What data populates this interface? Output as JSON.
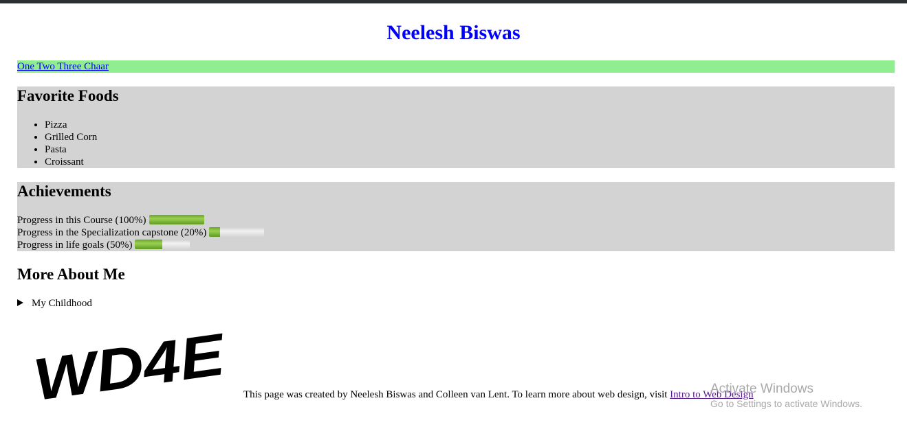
{
  "header": {
    "title": "Neelesh Biswas"
  },
  "nav": {
    "link_text": "One Two Three Chaar"
  },
  "favorite_foods": {
    "title": "Favorite Foods",
    "items": [
      "Pizza",
      "Grilled Corn",
      "Pasta",
      "Croissant"
    ]
  },
  "achievements": {
    "title": "Achievements",
    "rows": [
      {
        "label": "Progress in this Course (100%)",
        "value": 100
      },
      {
        "label": "Progress in the Specialization capstone (20%)",
        "value": 20
      },
      {
        "label": "Progress in life goals (50%)",
        "value": 50
      }
    ]
  },
  "more_about": {
    "title": "More About Me",
    "details_summary": "My Childhood"
  },
  "logo": {
    "text": "WD4E"
  },
  "footer": {
    "text": "This page was created by Neelesh Biswas and Colleen van Lent. To learn more about web design, visit ",
    "link_text": "Intro to Web Design"
  },
  "watermark": {
    "title": "Activate Windows",
    "subtitle": "Go to Settings to activate Windows."
  },
  "colors": {
    "title": "#0000ff",
    "nav_bg": "#90ee90",
    "section_bg": "#d3d3d3",
    "progress_fill": "#7dbb3c"
  }
}
